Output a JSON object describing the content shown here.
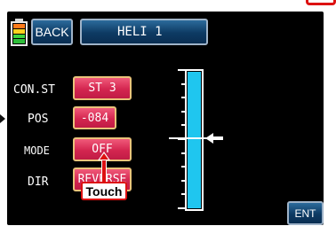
{
  "header": {
    "back_label": "BACK",
    "title": "HELI 1"
  },
  "battery": {
    "cell_colors": [
      "#ff7a1a",
      "#ffd21f",
      "#3fd23f",
      "#2fbf3a"
    ]
  },
  "settings": [
    {
      "label": "CON.ST",
      "value": "ST 3"
    },
    {
      "label": "POS",
      "value": "-084"
    },
    {
      "label": "MODE",
      "value": "OFF"
    },
    {
      "label": "DIR",
      "value": "REVERSE"
    }
  ],
  "callout": {
    "label": "Touch"
  },
  "gauge": {
    "level_fraction": 1.0,
    "indicator_fraction": 0.5,
    "fill_color": "#1fc6ef"
  },
  "footer": {
    "ent_label": "ENT"
  },
  "colors": {
    "screen_background": "#000000",
    "blue_button": "#0d3a63",
    "red_button": "#d42650",
    "callout_red": "#dd1111"
  }
}
